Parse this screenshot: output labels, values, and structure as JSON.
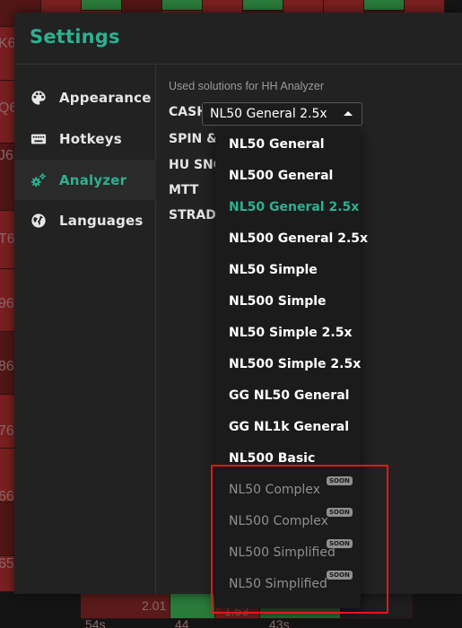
{
  "background": {
    "edge_labels": [
      "K6",
      "Q6",
      "J6s",
      "T6",
      "96",
      "86",
      "76",
      "66",
      "65"
    ],
    "bottom_values": [
      "2.01",
      "1.53"
    ],
    "bottom_labels": [
      "54s",
      "44",
      "43s"
    ],
    "colors": {
      "red": "#7a1f1f",
      "dark_red": "#521616",
      "green": "#2a7a3a",
      "dark": "#1a1a1a"
    }
  },
  "modal": {
    "title": "Settings",
    "accent_color": "#2bb191"
  },
  "sidebar": {
    "items": [
      {
        "label": "Appearance",
        "icon": "palette-icon",
        "active": false
      },
      {
        "label": "Hotkeys",
        "icon": "keyboard-icon",
        "active": false
      },
      {
        "label": "Analyzer",
        "icon": "gears-icon",
        "active": true
      },
      {
        "label": "Languages",
        "icon": "globe-icon",
        "active": false
      }
    ]
  },
  "content": {
    "caption": "Used solutions for HH Analyzer",
    "rows": [
      {
        "label": "CASH"
      },
      {
        "label": "SPIN & G"
      },
      {
        "label": "HU SNG"
      },
      {
        "label": "MTT"
      },
      {
        "label": "STRADD"
      }
    ],
    "select": {
      "value": "NL50 General 2.5x",
      "caret": "caret-up-icon"
    }
  },
  "dropdown": {
    "options": [
      {
        "label": "NL50 General",
        "state": "normal"
      },
      {
        "label": "NL500 General",
        "state": "normal"
      },
      {
        "label": "NL50 General 2.5x",
        "state": "selected"
      },
      {
        "label": "NL500 General 2.5x",
        "state": "normal"
      },
      {
        "label": "NL50 Simple",
        "state": "normal"
      },
      {
        "label": "NL500 Simple",
        "state": "normal"
      },
      {
        "label": "NL50 Simple 2.5x",
        "state": "normal"
      },
      {
        "label": "NL500 Simple 2.5x",
        "state": "normal"
      },
      {
        "label": "GG NL50 General",
        "state": "normal"
      },
      {
        "label": "GG NL1k General",
        "state": "normal"
      },
      {
        "label": "NL500 Basic",
        "state": "normal"
      },
      {
        "label": "NL50 Complex",
        "state": "disabled",
        "badge": "SOON"
      },
      {
        "label": "NL500 Complex",
        "state": "disabled",
        "badge": "SOON"
      },
      {
        "label": "NL500 Simplified",
        "state": "disabled",
        "badge": "SOON"
      },
      {
        "label": "NL50 Simplified",
        "state": "disabled",
        "badge": "SOON"
      }
    ]
  },
  "annotation": {
    "color": "#e8151b"
  }
}
